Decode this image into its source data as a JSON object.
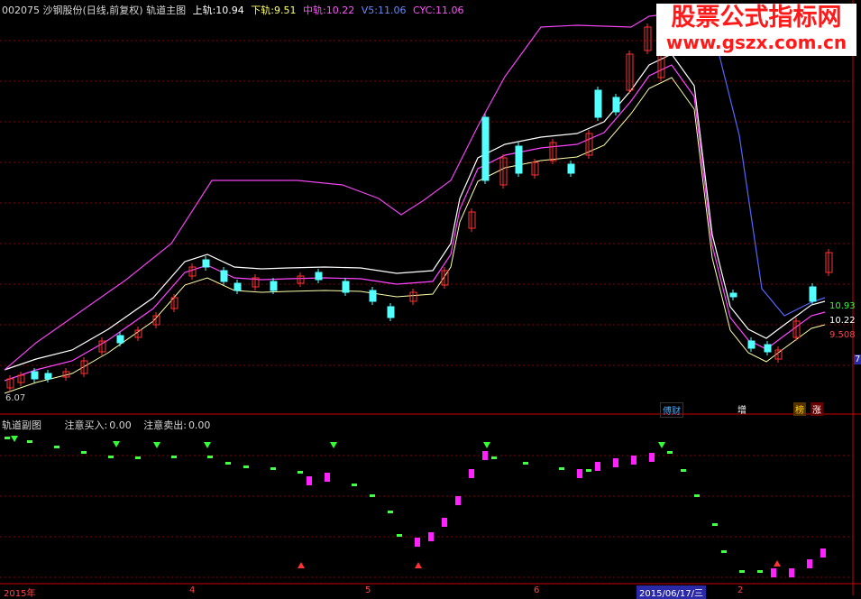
{
  "header": {
    "code_name": "002075 沙钢股份(日线,前复权) 轨道主图",
    "upper_label": "上轨:",
    "upper_value": "10.94",
    "lower_label": "下轨:",
    "lower_value": "9.51",
    "mid_label": "中轨:",
    "mid_value": "10.22",
    "v5_label": "V5:",
    "v5_value": "11.06",
    "cyc_label": "CYC:",
    "cyc_value": "11.06"
  },
  "watermark": {
    "title": "股票公式指标网",
    "url": "www.gszx.com.cn"
  },
  "main_price_labels": {
    "upper_right": "10.93",
    "mid_right": "10.22",
    "lower_right": "9.508",
    "low_marker": "6.07",
    "edge_tag": "7"
  },
  "event_badges": [
    {
      "text": "傅财",
      "color": "#44aaff"
    },
    {
      "text": "增",
      "color": "#ffffff"
    },
    {
      "text": "榜",
      "color": "#ffcc00"
    },
    {
      "text": "涨",
      "color": "#ffffff"
    }
  ],
  "sub_header": {
    "title": "轨道副图",
    "buy_label": "注意买入:",
    "buy_value": "0.00",
    "sell_label": "注意卖出:",
    "sell_value": "0.00"
  },
  "x_axis": {
    "labels": [
      "2015年",
      "4",
      "5",
      "6",
      "2"
    ],
    "date_box": "2015/06/17/三"
  },
  "colors": {
    "background": "#000000",
    "up_candle": "#ff3333",
    "down_candle": "#54ffff",
    "upper_band": "#ffffff",
    "mid_band": "#ff44ff",
    "lower_band": "#ffffaa",
    "cyc_line": "#ee44ee",
    "v5_line": "#5566ff",
    "buy_arrow": "#ff3333",
    "sell_arrow": "#33ff33",
    "grid": "#880000",
    "divider": "#cc0000"
  },
  "icons": {
    "buy": "red-up-arrow-icon",
    "sell": "green-down-arrow-icon"
  }
}
